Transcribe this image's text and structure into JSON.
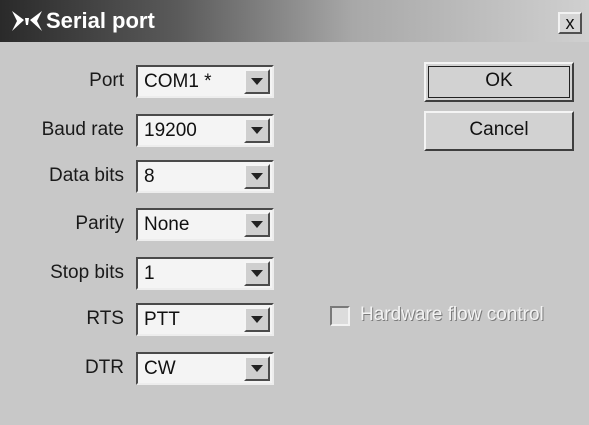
{
  "window": {
    "title": "Serial port",
    "close_glyph": "x"
  },
  "fields": [
    {
      "label": "Port",
      "value": "COM1 *"
    },
    {
      "label": "Baud rate",
      "value": "19200"
    },
    {
      "label": "Data bits",
      "value": "8"
    },
    {
      "label": "Parity",
      "value": "None"
    },
    {
      "label": "Stop bits",
      "value": "1"
    },
    {
      "label": "RTS",
      "value": "PTT"
    },
    {
      "label": "DTR",
      "value": "CW"
    }
  ],
  "buttons": {
    "ok": "OK",
    "cancel": "Cancel"
  },
  "hardware_flow_control": {
    "label": "Hardware flow control",
    "checked": false,
    "enabled": false
  },
  "icons": {
    "app": "butterfly-app-icon",
    "dropdown": "chevron-down-icon"
  }
}
